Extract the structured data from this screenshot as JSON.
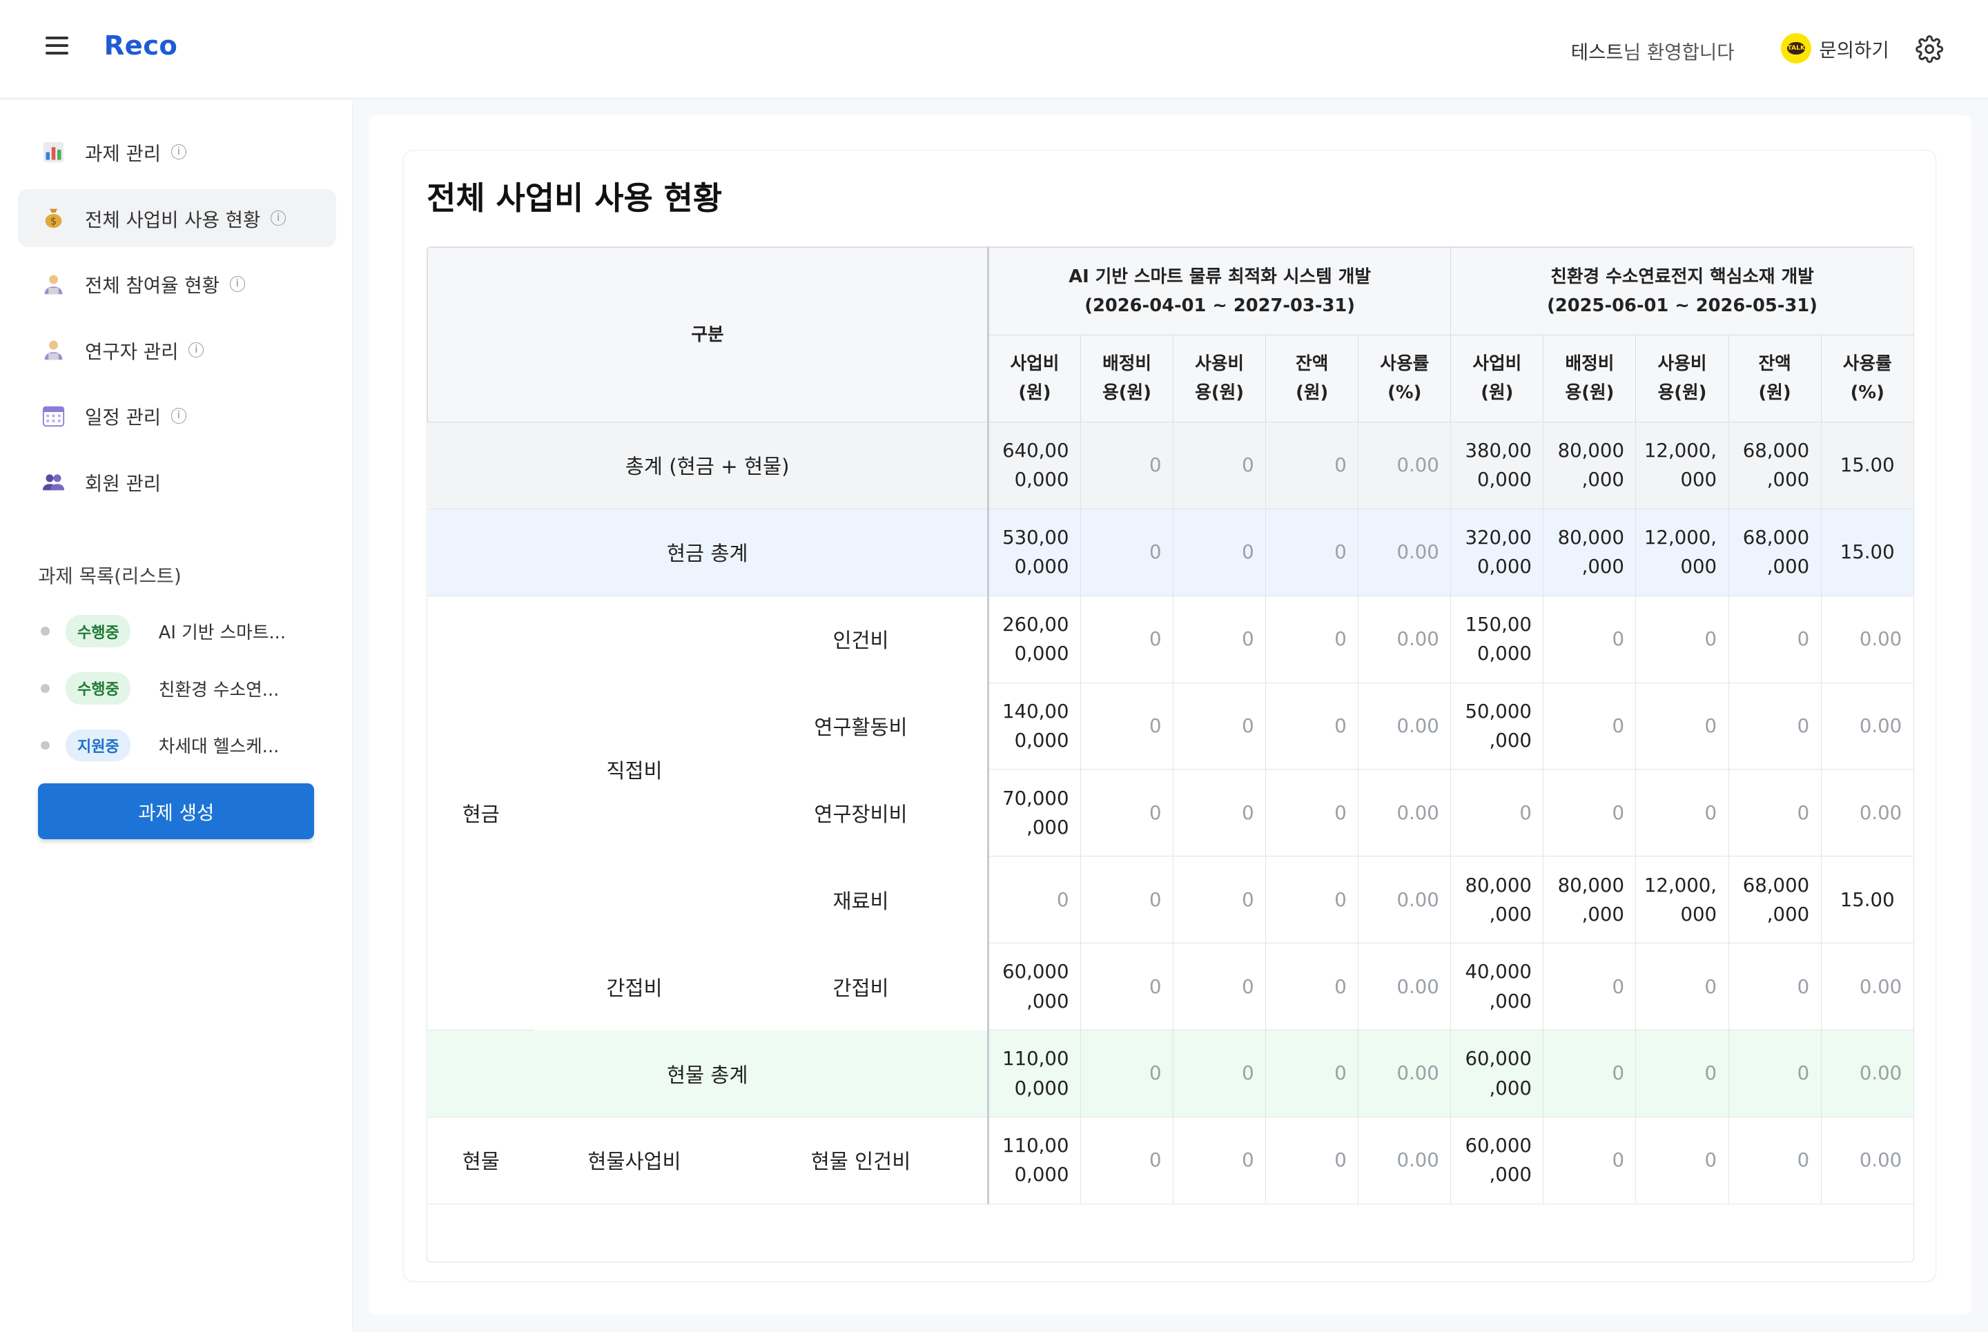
{
  "header": {
    "logo": "Reco",
    "welcome_name": "테스트",
    "welcome_suffix": "님 환영합니다",
    "contact_label": "문의하기"
  },
  "sidebar": {
    "items": [
      {
        "label": "과제 관리",
        "icon": "bar-chart-icon"
      },
      {
        "label": "전체 사업비 사용 현황",
        "icon": "money-bag-icon"
      },
      {
        "label": "전체 참여율 현황",
        "icon": "researcher-icon"
      },
      {
        "label": "연구자 관리",
        "icon": "researcher-icon"
      },
      {
        "label": "일정 관리",
        "icon": "calendar-icon"
      },
      {
        "label": "회원 관리",
        "icon": "members-icon"
      }
    ],
    "list_title": "과제 목록(리스트)",
    "projects": [
      {
        "status": "수행중",
        "name": "AI 기반 스마트..."
      },
      {
        "status": "수행중",
        "name": "친환경 수소연..."
      },
      {
        "status": "지원중",
        "name": "차세대 헬스케..."
      }
    ],
    "create_button": "과제 생성"
  },
  "main": {
    "title": "전체 사업비 사용 현황",
    "table": {
      "category_header": "구분",
      "projects": [
        {
          "name": "AI 기반 스마트 물류 최적화 시스템 개발",
          "period": "(2026-04-01 ~ 2027-03-31)"
        },
        {
          "name": "친환경 수소연료전지 핵심소재 개발",
          "period": "(2025-06-01 ~ 2026-05-31)"
        }
      ],
      "columns": [
        [
          "사업비",
          "(원)"
        ],
        [
          "배정비",
          "용(원)"
        ],
        [
          "사용비",
          "용(원)"
        ],
        [
          "잔액",
          "(원)"
        ],
        [
          "사용률",
          "(%)"
        ]
      ],
      "labels": {
        "grand_total": "총계 (현금 + 현물)",
        "cash_total": "현금 총계",
        "cash": "현금",
        "direct": "직접비",
        "indirect": "간접비",
        "labor": "인건비",
        "research_activity": "연구활동비",
        "research_equipment": "연구장비비",
        "material": "재료비",
        "indirect_item": "간접비",
        "kind_total": "현물 총계",
        "kind": "현물",
        "kind_business": "현물사업비",
        "kind_labor": "현물 인건비"
      },
      "rows": {
        "grand_total": [
          [
            "640,00",
            "0,000"
          ],
          "0",
          "0",
          "0",
          "0.00",
          [
            "380,00",
            "0,000"
          ],
          [
            "80,000",
            ",000"
          ],
          [
            "12,000,",
            "000"
          ],
          [
            "68,000",
            ",000"
          ],
          "15.00"
        ],
        "cash_total": [
          [
            "530,00",
            "0,000"
          ],
          "0",
          "0",
          "0",
          "0.00",
          [
            "320,00",
            "0,000"
          ],
          [
            "80,000",
            ",000"
          ],
          [
            "12,000,",
            "000"
          ],
          [
            "68,000",
            ",000"
          ],
          "15.00"
        ],
        "labor": [
          [
            "260,00",
            "0,000"
          ],
          "0",
          "0",
          "0",
          "0.00",
          [
            "150,00",
            "0,000"
          ],
          "0",
          "0",
          "0",
          "0.00"
        ],
        "research_activity": [
          [
            "140,00",
            "0,000"
          ],
          "0",
          "0",
          "0",
          "0.00",
          [
            "50,000",
            ",000"
          ],
          "0",
          "0",
          "0",
          "0.00"
        ],
        "research_equipment": [
          [
            "70,000",
            ",000"
          ],
          "0",
          "0",
          "0",
          "0.00",
          "0",
          "0",
          "0",
          "0",
          "0.00"
        ],
        "material": [
          "0",
          "0",
          "0",
          "0",
          "0.00",
          [
            "80,000",
            ",000"
          ],
          [
            "80,000",
            ",000"
          ],
          [
            "12,000,",
            "000"
          ],
          [
            "68,000",
            ",000"
          ],
          "15.00"
        ],
        "indirect_item": [
          [
            "60,000",
            ",000"
          ],
          "0",
          "0",
          "0",
          "0.00",
          [
            "40,000",
            ",000"
          ],
          "0",
          "0",
          "0",
          "0.00"
        ],
        "kind_total": [
          [
            "110,00",
            "0,000"
          ],
          "0",
          "0",
          "0",
          "0.00",
          [
            "60,000",
            ",000"
          ],
          "0",
          "0",
          "0",
          "0.00"
        ],
        "kind_labor": [
          [
            "110,00",
            "0,000"
          ],
          "0",
          "0",
          "0",
          "0.00",
          [
            "60,000",
            ",000"
          ],
          "0",
          "0",
          "0",
          "0.00"
        ]
      }
    }
  }
}
